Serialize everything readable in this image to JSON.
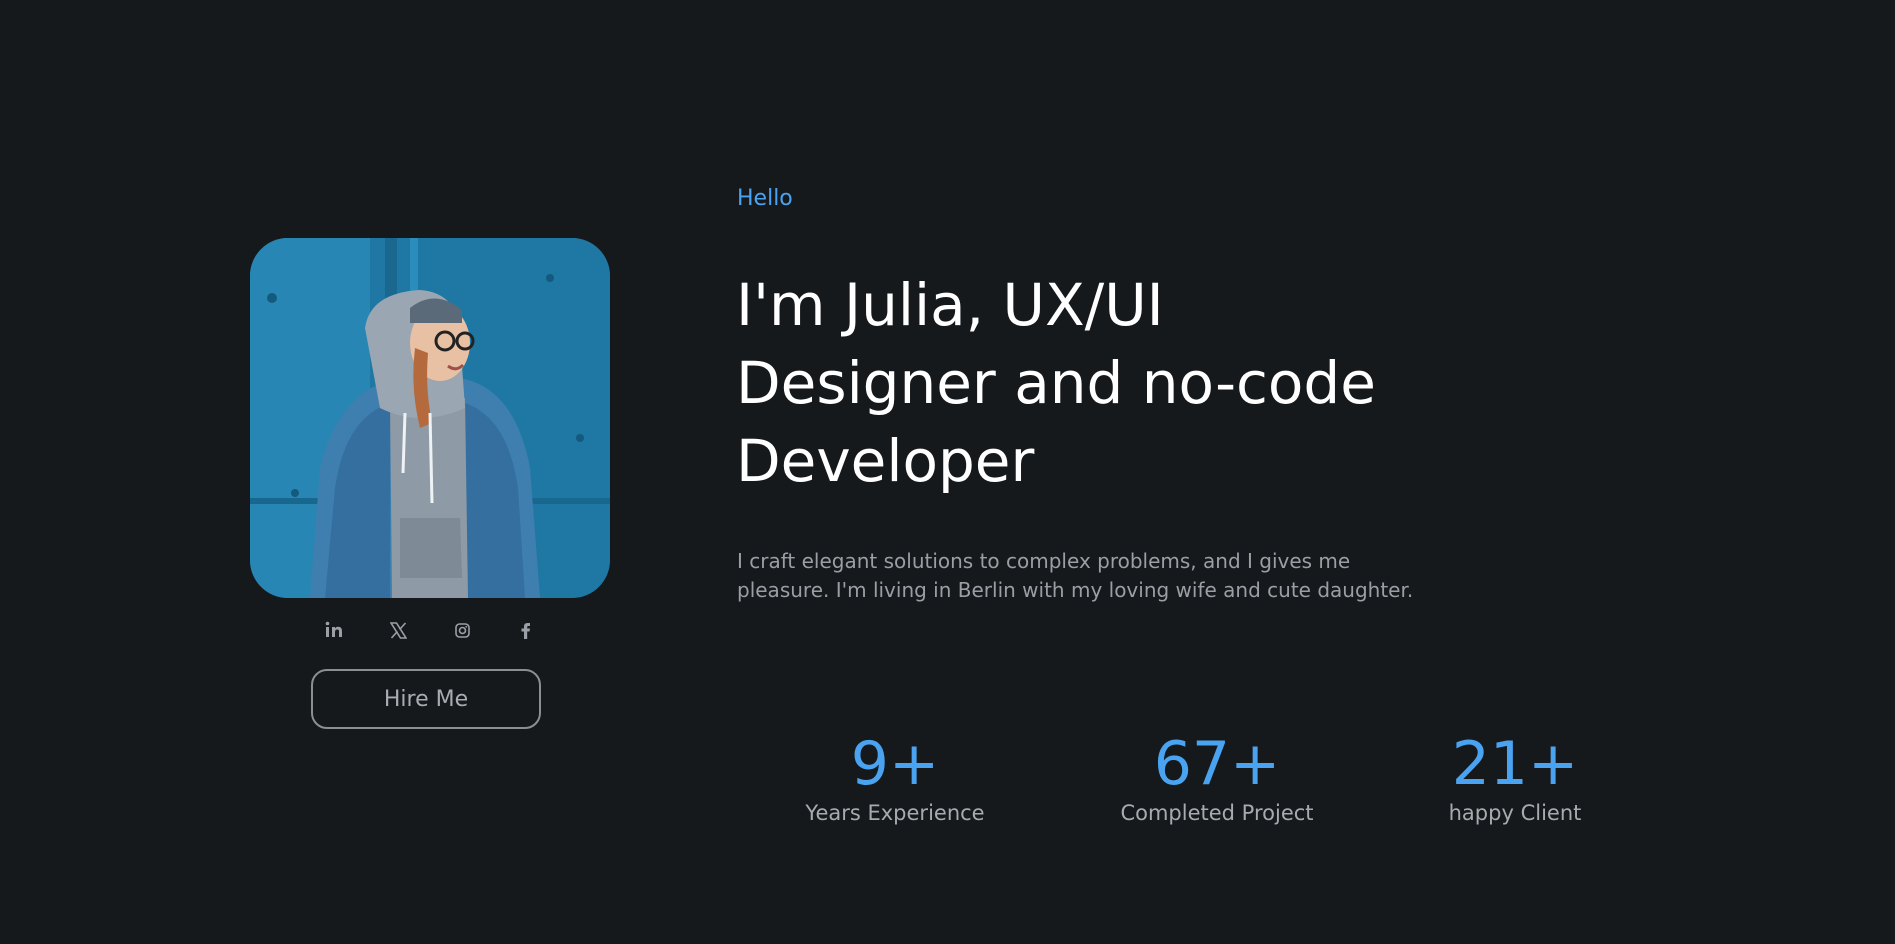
{
  "hero": {
    "greeting": "Hello",
    "headline_lines": [
      "I'm Julia, UX/UI",
      "Designer and no-code",
      "Developer"
    ],
    "intro_lines": [
      "I craft elegant solutions to complex problems, and I gives me",
      "pleasure. I'm living in Berlin with my loving wife and cute daughter."
    ]
  },
  "profile": {
    "photo_alt": "portrait-photo",
    "socials": [
      {
        "name": "linkedin",
        "icon": "linkedin-icon",
        "glyph": "in"
      },
      {
        "name": "x",
        "icon": "x-icon",
        "glyph": "𝕏"
      },
      {
        "name": "instagram",
        "icon": "instagram-icon",
        "glyph": ""
      },
      {
        "name": "facebook",
        "icon": "facebook-icon",
        "glyph": "f"
      }
    ],
    "hire_label": "Hire Me"
  },
  "stats": [
    {
      "value": "9+",
      "label": "Years Experience"
    },
    {
      "value": "67+",
      "label": "Completed Project"
    },
    {
      "value": "21+",
      "label": "happy Client"
    }
  ],
  "colors": {
    "background": "#16191c",
    "accent": "#4aa3f0",
    "text_primary": "#ffffff",
    "text_muted": "#9a9fa5"
  }
}
